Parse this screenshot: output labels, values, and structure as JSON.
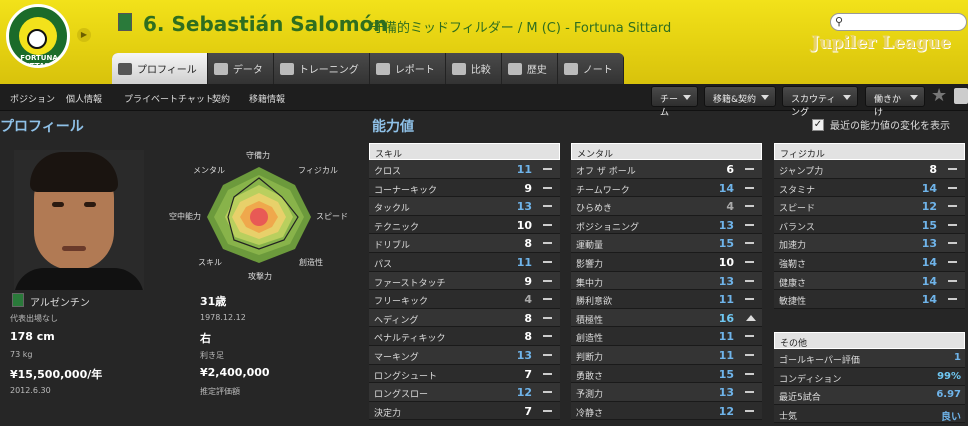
{
  "header": {
    "club_crest_text": "FORTUNA SITTARD",
    "player_title": "6. Sebastián Salomón",
    "player_subtitle": "守備的ミッドフィルダー / M (C) - Fortuna Sittard",
    "league_logo": "Jupiler League",
    "search_icon": "search-icon"
  },
  "tabs": [
    {
      "label": "プロフィール",
      "icon": "profile-icon",
      "active": true
    },
    {
      "label": "データ",
      "icon": "chart-icon",
      "active": false
    },
    {
      "label": "トレーニング",
      "icon": "ball-icon",
      "active": false
    },
    {
      "label": "レポート",
      "icon": "report-icon",
      "active": false
    },
    {
      "label": "比較",
      "icon": "compare-icon",
      "active": false
    },
    {
      "label": "歴史",
      "icon": "history-icon",
      "active": false
    },
    {
      "label": "ノート",
      "icon": "note-icon",
      "active": false
    }
  ],
  "subnav": [
    "ポジション",
    "個人情報",
    "プライベートチャット",
    "契約",
    "移籍情報"
  ],
  "dropdowns": [
    "チーム",
    "移籍&契約",
    "スカウティング",
    "働きかけ"
  ],
  "sections": {
    "profile_title": "プロフィール",
    "attributes_title": "能力値",
    "show_changes": "最近の能力値の変化を表示"
  },
  "radar": {
    "labels": [
      "守備力",
      "フィジカル",
      "スピード",
      "創造性",
      "攻撃力",
      "スキル",
      "空中能力",
      "メンタル"
    ]
  },
  "info": {
    "nationality": "アルゼンチン",
    "age": "31歳",
    "intl": "代表出場なし",
    "dob": "1978.12.12",
    "height": "178 cm",
    "foot": "右",
    "weight": "73 kg",
    "foot_label": "利き足",
    "salary": "¥15,500,000/年",
    "value": "¥2,400,000",
    "contract": "2012.6.30",
    "value_label": "推定評価額"
  },
  "columns": [
    {
      "title": "スキル",
      "rows": [
        {
          "name": "クロス",
          "value": "11",
          "color": "blue",
          "trend": "dash"
        },
        {
          "name": "コーナーキック",
          "value": "9",
          "color": "white",
          "trend": "dash"
        },
        {
          "name": "タックル",
          "value": "13",
          "color": "blue",
          "trend": "dash"
        },
        {
          "name": "テクニック",
          "value": "10",
          "color": "white",
          "trend": "dash"
        },
        {
          "name": "ドリブル",
          "value": "8",
          "color": "white",
          "trend": "dash"
        },
        {
          "name": "パス",
          "value": "11",
          "color": "blue",
          "trend": "dash"
        },
        {
          "name": "ファーストタッチ",
          "value": "9",
          "color": "white",
          "trend": "dash"
        },
        {
          "name": "フリーキック",
          "value": "4",
          "color": "gray",
          "trend": "dash"
        },
        {
          "name": "ヘディング",
          "value": "8",
          "color": "white",
          "trend": "dash"
        },
        {
          "name": "ペナルティキック",
          "value": "8",
          "color": "white",
          "trend": "dash"
        },
        {
          "name": "マーキング",
          "value": "13",
          "color": "blue",
          "trend": "dash"
        },
        {
          "name": "ロングシュート",
          "value": "7",
          "color": "white",
          "trend": "dash"
        },
        {
          "name": "ロングスロー",
          "value": "12",
          "color": "blue",
          "trend": "dash"
        },
        {
          "name": "決定力",
          "value": "7",
          "color": "white",
          "trend": "dash"
        }
      ]
    },
    {
      "title": "メンタル",
      "rows": [
        {
          "name": "オフ ザ ボール",
          "value": "6",
          "color": "white",
          "trend": "dash"
        },
        {
          "name": "チームワーク",
          "value": "14",
          "color": "blue",
          "trend": "dash"
        },
        {
          "name": "ひらめき",
          "value": "4",
          "color": "gray",
          "trend": "dash"
        },
        {
          "name": "ポジショニング",
          "value": "13",
          "color": "blue",
          "trend": "dash"
        },
        {
          "name": "運動量",
          "value": "15",
          "color": "blue",
          "trend": "dash"
        },
        {
          "name": "影響力",
          "value": "10",
          "color": "white",
          "trend": "dash"
        },
        {
          "name": "集中力",
          "value": "13",
          "color": "blue",
          "trend": "dash"
        },
        {
          "name": "勝利意欲",
          "value": "11",
          "color": "blue",
          "trend": "dash"
        },
        {
          "name": "積極性",
          "value": "16",
          "color": "cyan",
          "trend": "up"
        },
        {
          "name": "創造性",
          "value": "11",
          "color": "blue",
          "trend": "dash"
        },
        {
          "name": "判断力",
          "value": "11",
          "color": "blue",
          "trend": "dash"
        },
        {
          "name": "勇敢さ",
          "value": "15",
          "color": "blue",
          "trend": "dash"
        },
        {
          "name": "予測力",
          "value": "13",
          "color": "blue",
          "trend": "dash"
        },
        {
          "name": "冷静さ",
          "value": "12",
          "color": "blue",
          "trend": "dash"
        }
      ]
    },
    {
      "title": "フィジカル",
      "rows": [
        {
          "name": "ジャンプ力",
          "value": "8",
          "color": "white",
          "trend": "dash"
        },
        {
          "name": "スタミナ",
          "value": "14",
          "color": "blue",
          "trend": "dash"
        },
        {
          "name": "スピード",
          "value": "12",
          "color": "blue",
          "trend": "dash"
        },
        {
          "name": "バランス",
          "value": "15",
          "color": "blue",
          "trend": "dash"
        },
        {
          "name": "加速力",
          "value": "13",
          "color": "blue",
          "trend": "dash"
        },
        {
          "name": "強靭さ",
          "value": "14",
          "color": "blue",
          "trend": "dash"
        },
        {
          "name": "健康さ",
          "value": "14",
          "color": "blue",
          "trend": "dash"
        },
        {
          "name": "敏捷性",
          "value": "14",
          "color": "blue",
          "trend": "dash"
        }
      ]
    }
  ],
  "other": {
    "title": "その他",
    "rows": [
      {
        "name": "ゴールキーパー評価",
        "value": "1",
        "color": "blue"
      },
      {
        "name": "コンディション",
        "value": "99%",
        "color": "cyan"
      },
      {
        "name": "最近5試合",
        "value": "6.97",
        "color": "blue"
      },
      {
        "name": "士気",
        "value": "良い",
        "color": "blue"
      }
    ]
  },
  "colors": {
    "header": "#e6d314",
    "accent_blue": "#6fb4ea",
    "title_green": "#2f6e1f"
  }
}
